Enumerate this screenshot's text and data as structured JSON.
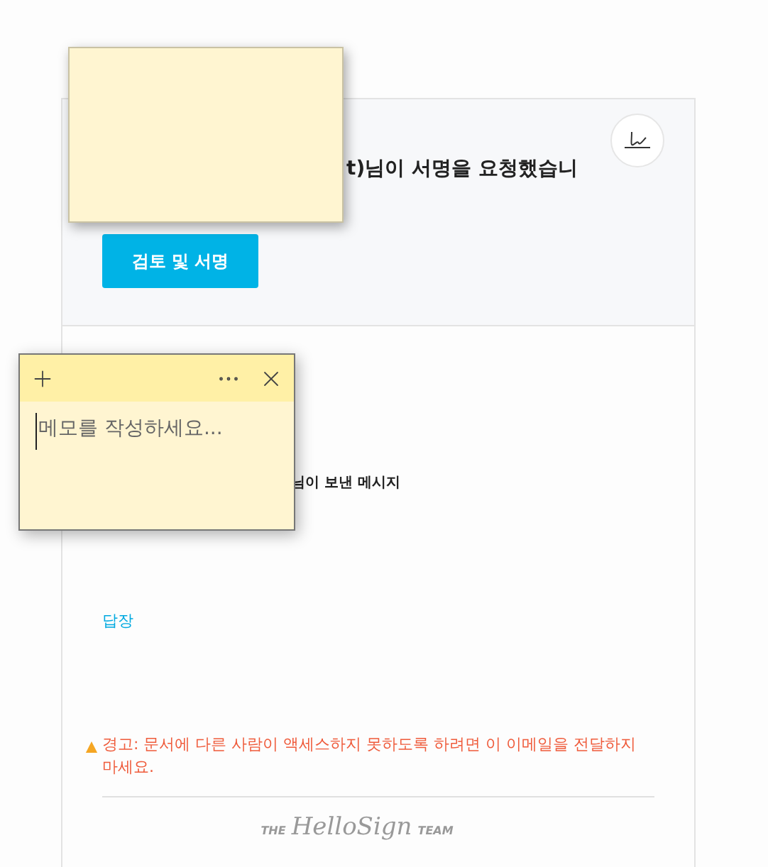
{
  "email": {
    "title": "t)님이 서명을 요청했습니",
    "review_button": "검토 및 서명",
    "message_heading": "님이 보낸 메시지",
    "reply_link": "답장",
    "warning": "경고: 문서에 다른 사람이 액세스하지 못하도록 하려면 이 이메일을 전달하지 마세요.",
    "signoff": {
      "prefix": "THE",
      "brand": "HelloSign",
      "suffix": "TEAM"
    }
  },
  "sticky_notes": [
    {
      "kind": "collapsed"
    },
    {
      "kind": "open",
      "placeholder": "메모를 작성하세요..."
    }
  ]
}
